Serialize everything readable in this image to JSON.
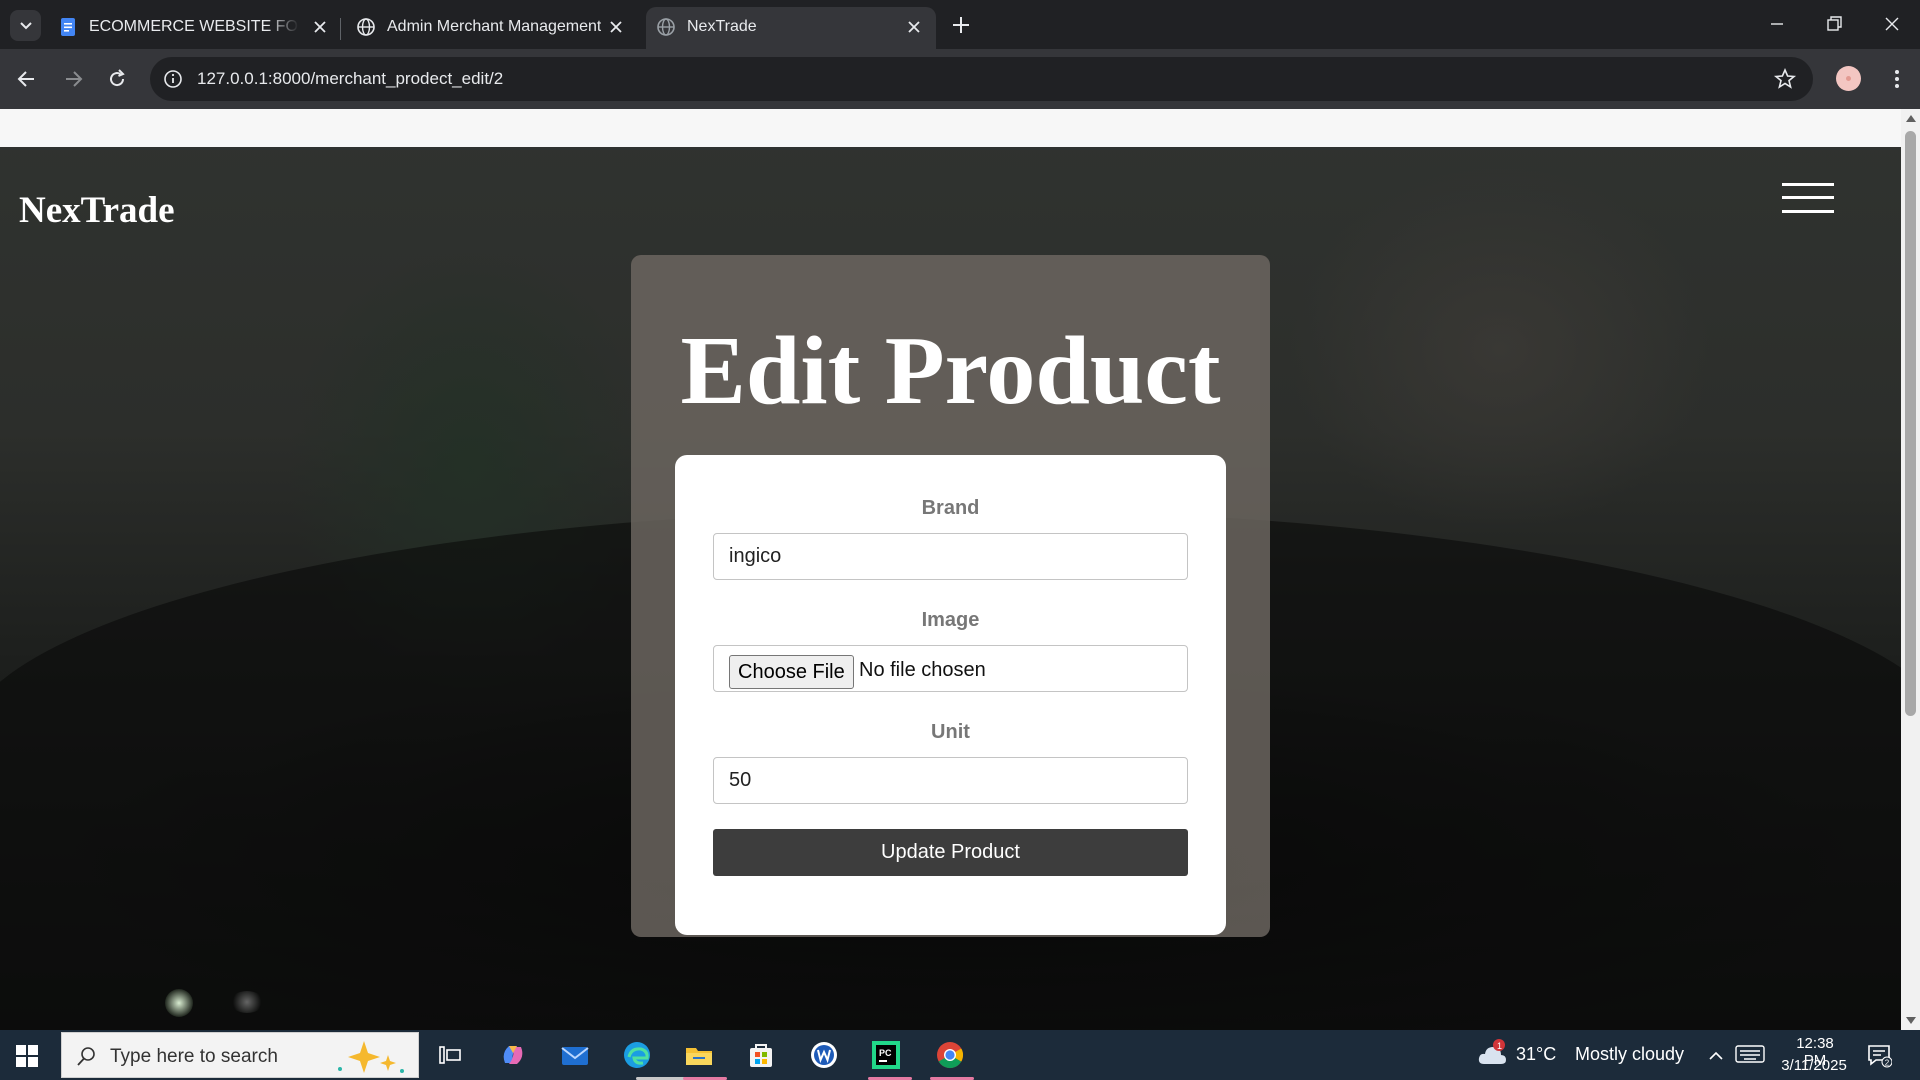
{
  "browser": {
    "tabs": [
      {
        "title": "ECOMMERCE WEBSITE FOR LOC",
        "icon": "google-docs-icon",
        "active": false
      },
      {
        "title": "Admin Merchant Management",
        "icon": "globe-icon",
        "active": false
      },
      {
        "title": "NexTrade",
        "icon": "globe-icon",
        "active": true
      }
    ],
    "url": "127.0.0.1:8000/merchant_prodect_edit/2"
  },
  "page": {
    "brand": "NexTrade",
    "heading": "Edit Product",
    "form": {
      "brand_label": "Brand",
      "brand_value": "ingico",
      "image_label": "Image",
      "file_button": "Choose File",
      "file_status": "No file chosen",
      "unit_label": "Unit",
      "unit_value": "50",
      "submit_label": "Update Product"
    }
  },
  "taskbar": {
    "search_placeholder": "Type here to search",
    "apps": [
      "task-view-icon",
      "copilot-icon",
      "mail-icon",
      "edge-icon",
      "file-explorer-icon",
      "microsoft-store-icon",
      "word-icon",
      "pycharm-icon",
      "chrome-icon"
    ],
    "weather_badge": "1",
    "temperature": "31°C",
    "condition": "Mostly cloudy",
    "time": "12:38 PM",
    "date": "3/11/2025",
    "notification_count": "2"
  },
  "colors": {
    "browser_frame": "#202124",
    "toolbar": "#35363a",
    "card_overlay": "#6e6862",
    "submit_button": "#3d3d3d",
    "taskbar": "#1c2b3a"
  }
}
